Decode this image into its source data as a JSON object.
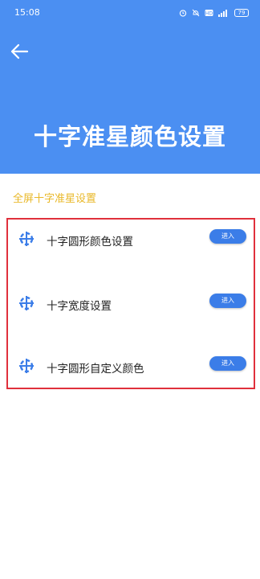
{
  "status_bar": {
    "time": "15:08",
    "battery": "79"
  },
  "header": {
    "title": "十字准星颜色设置",
    "background_color": "#4b8ff2"
  },
  "section": {
    "title": "全屏十字准星设置",
    "title_color": "#e9b828"
  },
  "items": [
    {
      "label": "十字圆形颜色设置",
      "button": "进入",
      "icon": "crosshair-icon"
    },
    {
      "label": "十字宽度设置",
      "button": "进入",
      "icon": "crosshair-icon"
    },
    {
      "label": "十字圆形自定义颜色",
      "button": "进入",
      "icon": "crosshair-icon"
    }
  ],
  "accent_color": "#3b7de8",
  "highlight_color": "#e0303c"
}
